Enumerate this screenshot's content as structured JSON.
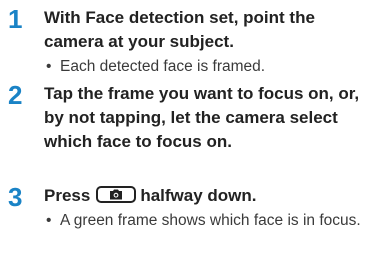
{
  "steps": [
    {
      "number": "1",
      "title": "With Face detection set, point the camera at your subject.",
      "bullet": "Each detected face is framed."
    },
    {
      "number": "2",
      "title": "Tap the frame you want to focus on, or, by not tapping, let the camera select which face to focus on."
    },
    {
      "number": "3",
      "title_before": "Press",
      "title_after": "halfway down.",
      "icon": "camera-shutter-icon",
      "bullet": "A green frame shows which face is in focus."
    }
  ],
  "bullet_glyph": "•",
  "colors": {
    "step_number": "#1a83c6",
    "title_text": "#222222",
    "body_text": "#3a3a3a"
  }
}
